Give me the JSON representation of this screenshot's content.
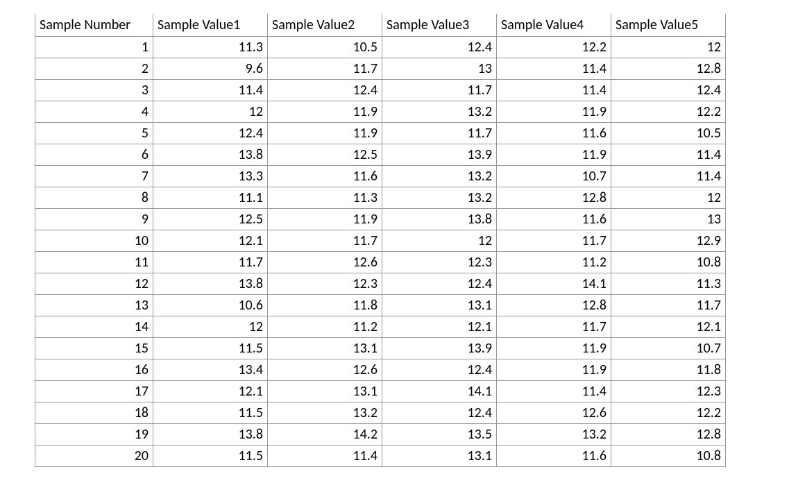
{
  "table": {
    "headers": [
      "Sample Number",
      "Sample Value1",
      "Sample Value2",
      "Sample Value3",
      "Sample Value4",
      "Sample Value5"
    ],
    "rows": [
      {
        "n": "1",
        "v1": "11.3",
        "v2": "10.5",
        "v3": "12.4",
        "v4": "12.2",
        "v5": "12"
      },
      {
        "n": "2",
        "v1": "9.6",
        "v2": "11.7",
        "v3": "13",
        "v4": "11.4",
        "v5": "12.8"
      },
      {
        "n": "3",
        "v1": "11.4",
        "v2": "12.4",
        "v3": "11.7",
        "v4": "11.4",
        "v5": "12.4"
      },
      {
        "n": "4",
        "v1": "12",
        "v2": "11.9",
        "v3": "13.2",
        "v4": "11.9",
        "v5": "12.2"
      },
      {
        "n": "5",
        "v1": "12.4",
        "v2": "11.9",
        "v3": "11.7",
        "v4": "11.6",
        "v5": "10.5"
      },
      {
        "n": "6",
        "v1": "13.8",
        "v2": "12.5",
        "v3": "13.9",
        "v4": "11.9",
        "v5": "11.4"
      },
      {
        "n": "7",
        "v1": "13.3",
        "v2": "11.6",
        "v3": "13.2",
        "v4": "10.7",
        "v5": "11.4"
      },
      {
        "n": "8",
        "v1": "11.1",
        "v2": "11.3",
        "v3": "13.2",
        "v4": "12.8",
        "v5": "12"
      },
      {
        "n": "9",
        "v1": "12.5",
        "v2": "11.9",
        "v3": "13.8",
        "v4": "11.6",
        "v5": "13"
      },
      {
        "n": "10",
        "v1": "12.1",
        "v2": "11.7",
        "v3": "12",
        "v4": "11.7",
        "v5": "12.9"
      },
      {
        "n": "11",
        "v1": "11.7",
        "v2": "12.6",
        "v3": "12.3",
        "v4": "11.2",
        "v5": "10.8"
      },
      {
        "n": "12",
        "v1": "13.8",
        "v2": "12.3",
        "v3": "12.4",
        "v4": "14.1",
        "v5": "11.3"
      },
      {
        "n": "13",
        "v1": "10.6",
        "v2": "11.8",
        "v3": "13.1",
        "v4": "12.8",
        "v5": "11.7"
      },
      {
        "n": "14",
        "v1": "12",
        "v2": "11.2",
        "v3": "12.1",
        "v4": "11.7",
        "v5": "12.1"
      },
      {
        "n": "15",
        "v1": "11.5",
        "v2": "13.1",
        "v3": "13.9",
        "v4": "11.9",
        "v5": "10.7"
      },
      {
        "n": "16",
        "v1": "13.4",
        "v2": "12.6",
        "v3": "12.4",
        "v4": "11.9",
        "v5": "11.8"
      },
      {
        "n": "17",
        "v1": "12.1",
        "v2": "13.1",
        "v3": "14.1",
        "v4": "11.4",
        "v5": "12.3"
      },
      {
        "n": "18",
        "v1": "11.5",
        "v2": "13.2",
        "v3": "12.4",
        "v4": "12.6",
        "v5": "12.2"
      },
      {
        "n": "19",
        "v1": "13.8",
        "v2": "14.2",
        "v3": "13.5",
        "v4": "13.2",
        "v5": "12.8"
      },
      {
        "n": "20",
        "v1": "11.5",
        "v2": "11.4",
        "v3": "13.1",
        "v4": "11.6",
        "v5": "10.8"
      }
    ]
  },
  "chart_data": {
    "type": "table",
    "title": "",
    "columns": [
      "Sample Number",
      "Sample Value1",
      "Sample Value2",
      "Sample Value3",
      "Sample Value4",
      "Sample Value5"
    ],
    "rows": [
      [
        1,
        11.3,
        10.5,
        12.4,
        12.2,
        12
      ],
      [
        2,
        9.6,
        11.7,
        13,
        11.4,
        12.8
      ],
      [
        3,
        11.4,
        12.4,
        11.7,
        11.4,
        12.4
      ],
      [
        4,
        12,
        11.9,
        13.2,
        11.9,
        12.2
      ],
      [
        5,
        12.4,
        11.9,
        11.7,
        11.6,
        10.5
      ],
      [
        6,
        13.8,
        12.5,
        13.9,
        11.9,
        11.4
      ],
      [
        7,
        13.3,
        11.6,
        13.2,
        10.7,
        11.4
      ],
      [
        8,
        11.1,
        11.3,
        13.2,
        12.8,
        12
      ],
      [
        9,
        12.5,
        11.9,
        13.8,
        11.6,
        13
      ],
      [
        10,
        12.1,
        11.7,
        12,
        11.7,
        12.9
      ],
      [
        11,
        11.7,
        12.6,
        12.3,
        11.2,
        10.8
      ],
      [
        12,
        13.8,
        12.3,
        12.4,
        14.1,
        11.3
      ],
      [
        13,
        10.6,
        11.8,
        13.1,
        12.8,
        11.7
      ],
      [
        14,
        12,
        11.2,
        12.1,
        11.7,
        12.1
      ],
      [
        15,
        11.5,
        13.1,
        13.9,
        11.9,
        10.7
      ],
      [
        16,
        13.4,
        12.6,
        12.4,
        11.9,
        11.8
      ],
      [
        17,
        12.1,
        13.1,
        14.1,
        11.4,
        12.3
      ],
      [
        18,
        11.5,
        13.2,
        12.4,
        12.6,
        12.2
      ],
      [
        19,
        13.8,
        14.2,
        13.5,
        13.2,
        12.8
      ],
      [
        20,
        11.5,
        11.4,
        13.1,
        11.6,
        10.8
      ]
    ]
  }
}
